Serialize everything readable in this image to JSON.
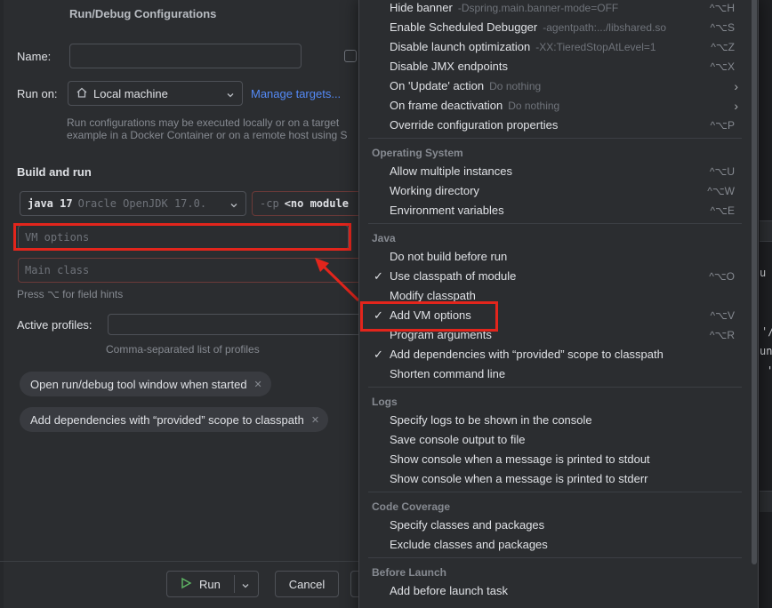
{
  "dialog": {
    "title": "Run/Debug Configurations",
    "name_label": "Name:",
    "name_value": "",
    "run_on_label": "Run on:",
    "run_on_value": "Local machine",
    "manage_targets": "Manage targets...",
    "run_on_hint_line1": "Run configurations may be executed locally or on a target",
    "run_on_hint_line2": "example in a Docker Container or on a remote host using S",
    "build_and_run": "Build and run",
    "jdk_main": "java 17",
    "jdk_detail": "Oracle OpenJDK 17.0.",
    "cp_prefix": "-cp",
    "cp_value": "<no module",
    "vm_options_placeholder": "VM options",
    "main_class_placeholder": "Main class",
    "field_hint": "Press ⌥ for field hints",
    "active_profiles_label": "Active profiles:",
    "active_profiles_value": "",
    "active_profiles_hint": "Comma-separated list of profiles",
    "chips": [
      "Open run/debug tool window when started",
      "Add dependencies with “provided” scope to classpath"
    ],
    "run_button": "Run",
    "cancel_button": "Cancel"
  },
  "menu": {
    "items_top": [
      {
        "label": "Hide banner",
        "sub": "-Dspring.main.banner-mode=OFF",
        "shortcut": "^⌥H"
      },
      {
        "label": "Enable Scheduled Debugger",
        "sub": "-agentpath:.../libshared.so",
        "shortcut": "^⌥S"
      },
      {
        "label": "Disable launch optimization",
        "sub": "-XX:TieredStopAtLevel=1",
        "shortcut": "^⌥Z"
      },
      {
        "label": "Disable JMX endpoints",
        "sub": "",
        "shortcut": "^⌥X"
      },
      {
        "label": "On 'Update' action",
        "sub": "Do nothing",
        "shortcut": "›"
      },
      {
        "label": "On frame deactivation",
        "sub": "Do nothing",
        "shortcut": "›"
      },
      {
        "label": "Override configuration properties",
        "sub": "",
        "shortcut": "^⌥P"
      }
    ],
    "sections": {
      "os": "Operating System",
      "java": "Java",
      "logs": "Logs",
      "coverage": "Code Coverage",
      "before_launch": "Before Launch"
    },
    "items_os": [
      {
        "label": "Allow multiple instances",
        "shortcut": "^⌥U"
      },
      {
        "label": "Working directory",
        "shortcut": "^⌥W"
      },
      {
        "label": "Environment variables",
        "shortcut": "^⌥E"
      }
    ],
    "items_java": [
      {
        "label": "Do not build before run",
        "checked": false,
        "shortcut": ""
      },
      {
        "label": "Use classpath of module",
        "checked": true,
        "shortcut": "^⌥O"
      },
      {
        "label": "Modify classpath",
        "checked": false,
        "shortcut": ""
      },
      {
        "label": "Add VM options",
        "checked": true,
        "shortcut": "^⌥V"
      },
      {
        "label": "Program arguments",
        "checked": false,
        "shortcut": "^⌥R"
      },
      {
        "label": "Add dependencies with “provided” scope to classpath",
        "checked": true,
        "shortcut": ""
      },
      {
        "label": "Shorten command line",
        "checked": false,
        "shortcut": ""
      }
    ],
    "items_logs": [
      "Specify logs to be shown in the console",
      "Save console output to file",
      "Show console when a message is printed to stdout",
      "Show console when a message is printed to stderr"
    ],
    "items_coverage": [
      "Specify classes and packages",
      "Exclude classes and packages"
    ],
    "items_before_launch": [
      "Add before launch task"
    ],
    "check_glyph": "✓"
  },
  "colors": {
    "highlight_red": "#e3251c",
    "link_blue": "#548af7",
    "dialog_bg": "#2b2d30"
  }
}
